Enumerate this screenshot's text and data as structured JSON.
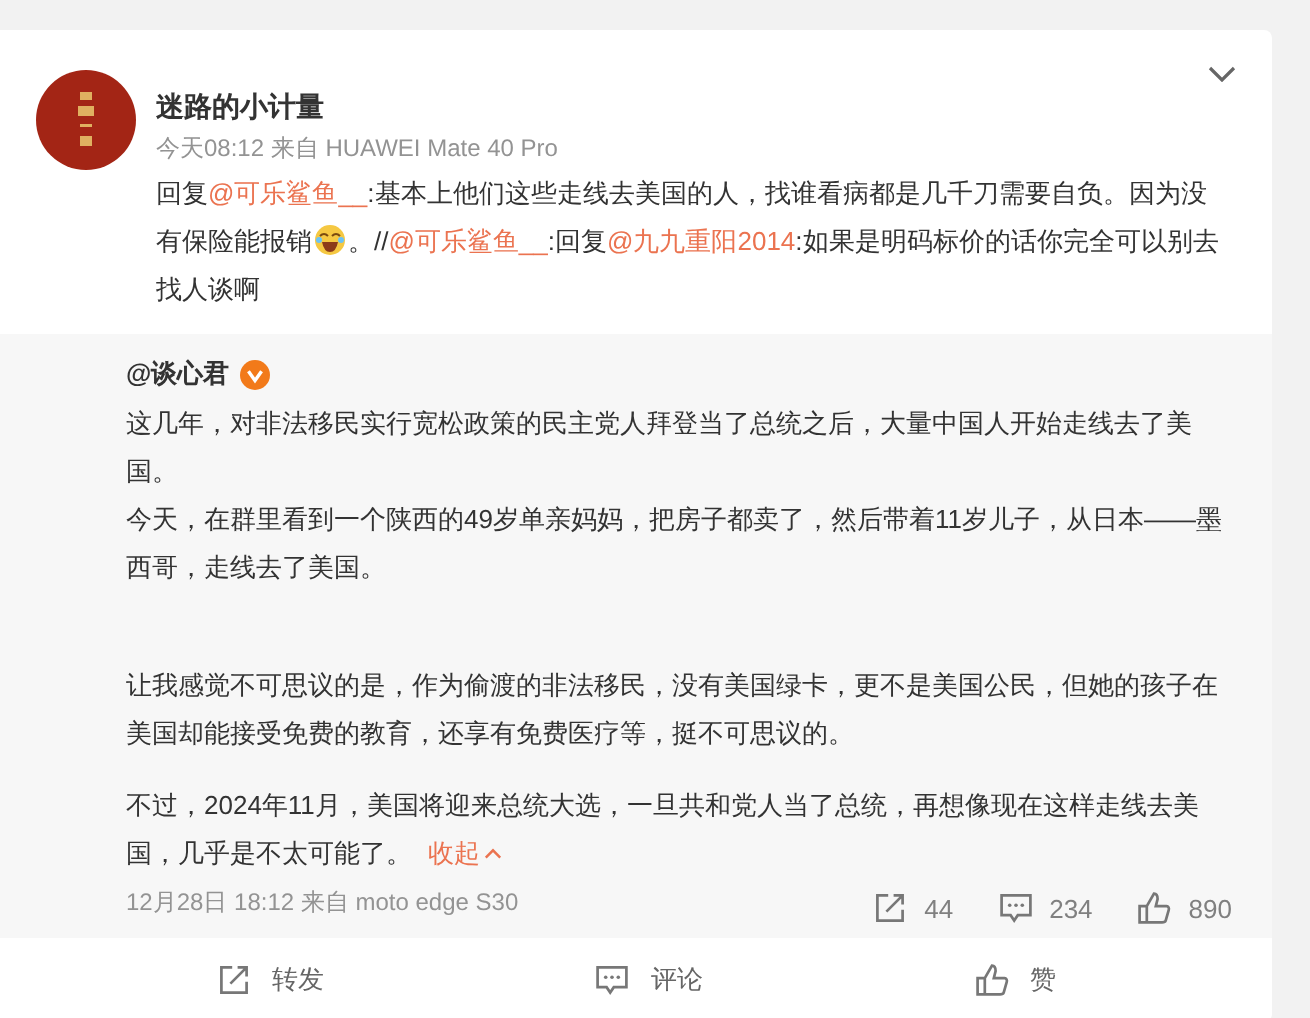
{
  "post": {
    "author": "迷路的小计量",
    "meta": "今天08:12 来自 HUAWEI Mate 40 Pro",
    "content": [
      {
        "kind": "text",
        "text": "回复"
      },
      {
        "kind": "mention",
        "text": "@可乐鲨鱼__"
      },
      {
        "kind": "text",
        "text": ":基本上他们这些走线去美国的人，找谁看病都是几千刀需要自负。因为没有保险能报销"
      },
      {
        "kind": "emoji"
      },
      {
        "kind": "text",
        "text": "。//"
      },
      {
        "kind": "mention",
        "text": "@可乐鲨鱼__"
      },
      {
        "kind": "text",
        "text": ":回复"
      },
      {
        "kind": "mention",
        "text": "@九九重阳2014"
      },
      {
        "kind": "text",
        "text": ":如果是明码标价的话你完全可以别去找人谈啊"
      }
    ]
  },
  "repost": {
    "author": "@谈心君",
    "verified": true,
    "paragraphs": [
      {
        "lines": [
          "这几年，对非法移民实行宽松政策的民主党人拜登当了总统之后，大量中国人开始走线去了美国。",
          "今天，在群里看到一个陕西的49岁单亲妈妈，把房子都卖了，然后带着11岁儿子，从日本——墨西哥，走线去了美国。"
        ]
      },
      {
        "lines": [
          "让我感觉不可思议的是，作为偷渡的非法移民，没有美国绿卡，更不是美国公民，但她的孩子在美国却能接受免费的教育，还享有免费医疗等，挺不可思议的。"
        ]
      },
      {
        "lines": [
          "不过，2024年11月，美国将迎来总统大选，一旦共和党人当了总统，再想像现在这样走线去美国，几乎是不太可能了。"
        ]
      }
    ],
    "collapse": "收起",
    "meta": "12月28日 18:12 来自 moto edge S30",
    "stats": [
      {
        "kind": "share",
        "count": "44"
      },
      {
        "kind": "comment",
        "count": "234"
      },
      {
        "kind": "like",
        "count": "890"
      }
    ]
  },
  "actions": [
    {
      "kind": "share",
      "label": "转发"
    },
    {
      "kind": "comment",
      "label": "评论"
    },
    {
      "kind": "like",
      "label": "赞"
    }
  ]
}
